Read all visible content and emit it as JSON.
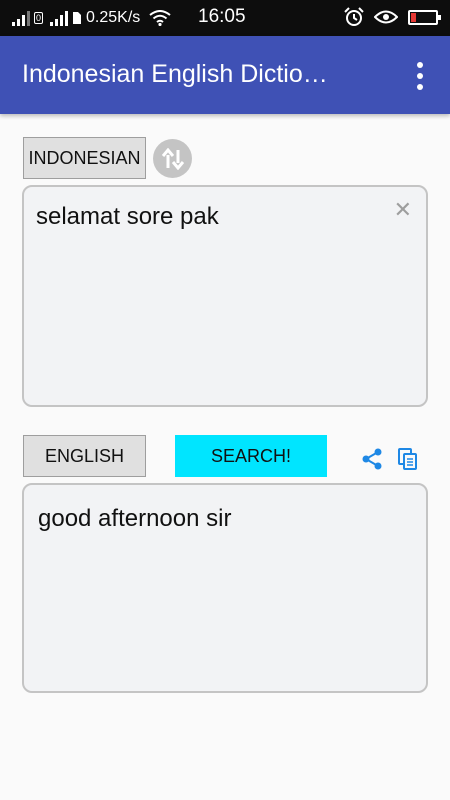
{
  "status_bar": {
    "net_speed": "0.25K/s",
    "time": "16:05",
    "sim_label": "0"
  },
  "app_bar": {
    "title": "Indonesian English Dictio…"
  },
  "source": {
    "language": "INDONESIAN",
    "text": "selamat sore pak"
  },
  "target": {
    "language": "ENGLISH",
    "text": "good afternoon sir"
  },
  "actions": {
    "search_label": "SEARCH!"
  },
  "colors": {
    "app_bar": "#3f51b5",
    "search_button": "#00e5ff",
    "action_icons": "#1e88e5",
    "battery_level": "#e53935"
  },
  "icons": [
    "signal-icon",
    "wifi-icon",
    "alarm-icon",
    "eye-icon",
    "battery-icon",
    "overflow-menu-icon",
    "swap-icon",
    "clear-icon",
    "share-icon",
    "copy-icon"
  ]
}
